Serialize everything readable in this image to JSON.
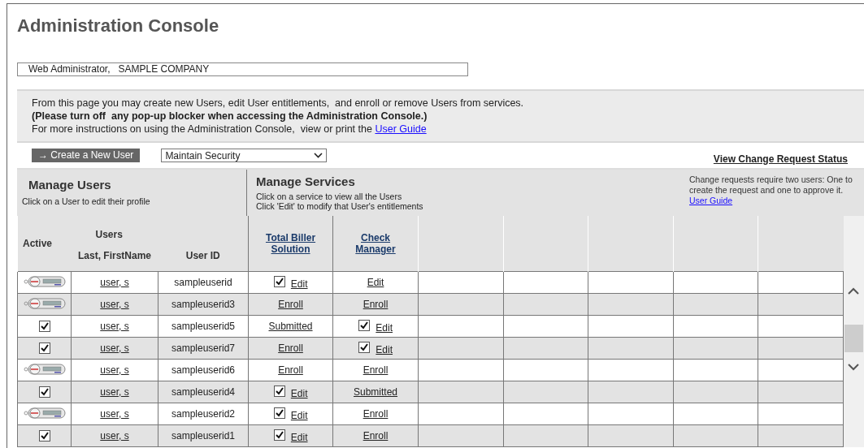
{
  "page_title": "Administration Console",
  "admin_field": "Web Administrator,   SAMPLE COMPANY",
  "info": {
    "line_1": "From this page you may create new Users, edit User entitlements,  and enroll or remove Users from services.",
    "line_2": "(Please turn off  any pop-up blocker when accessing the Administration Console.)",
    "line_3_text": "For more instructions on using the Administration Console,  view or print the",
    "line_3_link": "User Guide"
  },
  "toolbar": {
    "create_button": "→ Create a New User",
    "select_value": "Maintain Security",
    "status_link": "View Change Request Status"
  },
  "manage_users": {
    "title": "Manage Users",
    "subtitle": "Click on a User to edit their profile"
  },
  "manage_services": {
    "title": "Manage Services",
    "lines": [
      "Click on a service to view all the Users",
      "Click 'Edit' to modify that User's entitlements"
    ]
  },
  "note": {
    "text": "Change requests require two users: One to create the request and one to approve it.",
    "link": "User Guide"
  },
  "table": {
    "active_header": "Active",
    "users_header": "Users",
    "name_header": "Last,  FirstName",
    "userid_header": "User ID",
    "services": [
      "Total Biller Solution",
      "Check Manager"
    ],
    "rows": [
      {
        "active": {
          "kind": "token"
        },
        "name": "user, s",
        "user_id": "sampleuserid",
        "services": [
          {
            "kind": "enrolled",
            "checked": true,
            "link": "Edit"
          },
          {
            "kind": "link",
            "link": "Edit"
          }
        ]
      },
      {
        "active": {
          "kind": "token"
        },
        "name": "user, s",
        "user_id": "sampleuserid3",
        "services": [
          {
            "kind": "link",
            "link": "Enroll"
          },
          {
            "kind": "link",
            "link": "Enroll"
          }
        ]
      },
      {
        "active": {
          "kind": "checkbox",
          "checked": true
        },
        "name": "user, s",
        "user_id": "sampleuserid5",
        "services": [
          {
            "kind": "link",
            "link": "Submitted"
          },
          {
            "kind": "enrolled",
            "checked": true,
            "link": "Edit"
          }
        ]
      },
      {
        "active": {
          "kind": "checkbox",
          "checked": true
        },
        "name": "user, s",
        "user_id": "sampleuserid7",
        "services": [
          {
            "kind": "link",
            "link": "Enroll"
          },
          {
            "kind": "enrolled",
            "checked": true,
            "link": "Edit"
          }
        ]
      },
      {
        "active": {
          "kind": "token"
        },
        "name": "user, s",
        "user_id": "sampleuserid6",
        "services": [
          {
            "kind": "link",
            "link": "Enroll"
          },
          {
            "kind": "link",
            "link": "Enroll"
          }
        ]
      },
      {
        "active": {
          "kind": "checkbox",
          "checked": true
        },
        "name": "user, s",
        "user_id": "sampleuserid4",
        "services": [
          {
            "kind": "enrolled",
            "checked": true,
            "link": "Edit"
          },
          {
            "kind": "link",
            "link": "Submitted"
          }
        ]
      },
      {
        "active": {
          "kind": "token"
        },
        "name": "user, s",
        "user_id": "sampleuserid2",
        "services": [
          {
            "kind": "enrolled",
            "checked": true,
            "link": "Edit"
          },
          {
            "kind": "link",
            "link": "Enroll"
          }
        ]
      },
      {
        "active": {
          "kind": "checkbox",
          "checked": true
        },
        "name": "user, s",
        "user_id": "sampleuserid1",
        "services": [
          {
            "kind": "enrolled",
            "checked": true,
            "link": "Edit"
          },
          {
            "kind": "link",
            "link": "Enroll"
          }
        ]
      }
    ]
  }
}
